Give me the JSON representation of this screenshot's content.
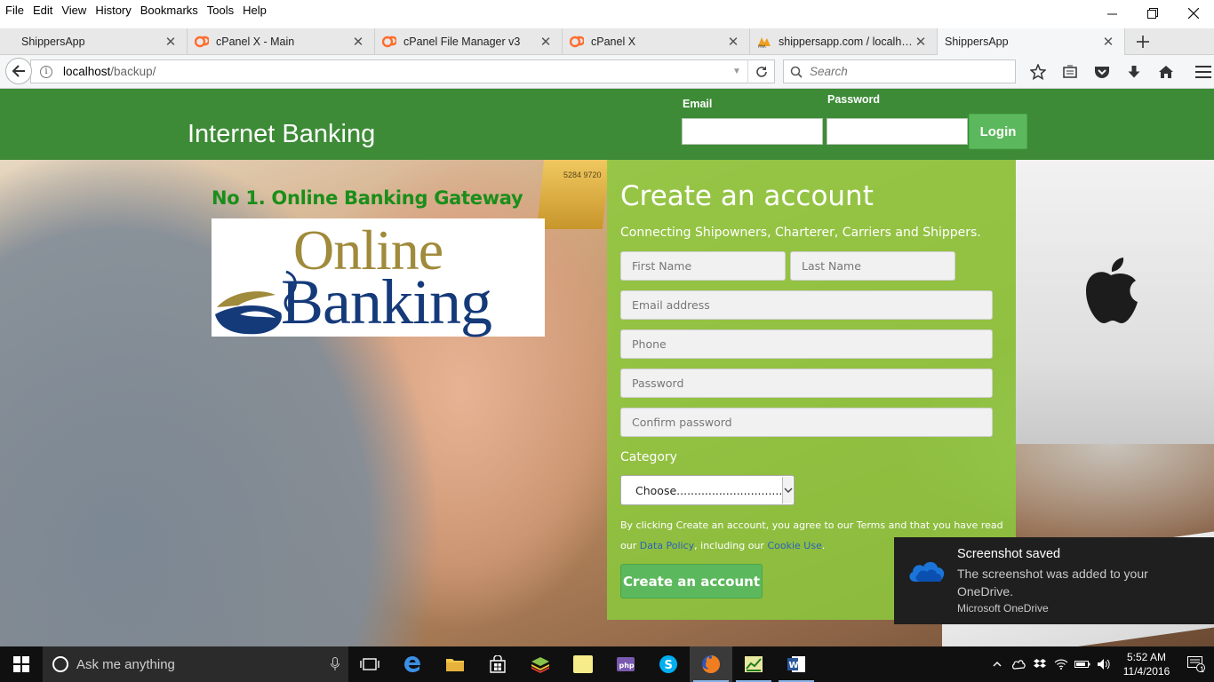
{
  "menubar": {
    "items": [
      {
        "label": "File"
      },
      {
        "label": "Edit"
      },
      {
        "label": "View"
      },
      {
        "label": "History"
      },
      {
        "label": "Bookmarks"
      },
      {
        "label": "Tools"
      },
      {
        "label": "Help"
      }
    ]
  },
  "tabs": [
    {
      "label": "ShippersApp",
      "icon": "none",
      "active": false
    },
    {
      "label": "cPanel X - Main",
      "icon": "cpanel-icon",
      "active": false
    },
    {
      "label": "cPanel File Manager v3",
      "icon": "cpanel-icon",
      "active": false
    },
    {
      "label": "cPanel X",
      "icon": "cpanel-icon",
      "active": false
    },
    {
      "label": "shippersapp.com / localh…",
      "icon": "phpmyadmin-icon",
      "active": false
    },
    {
      "label": "ShippersApp",
      "icon": "none",
      "active": true
    }
  ],
  "navbar": {
    "url_host": "localhost",
    "url_path": "/backup/",
    "search_placeholder": "Search"
  },
  "site": {
    "brand": "Internet Banking",
    "login": {
      "email_label": "Email",
      "password_label": "Password",
      "button": "Login"
    },
    "tagline": "No 1. Online Banking Gateway",
    "logo": {
      "line1": "Online",
      "line2": "Banking"
    },
    "hero_card_number": "5284 9720"
  },
  "signup": {
    "title": "Create an account",
    "subtitle": "Connecting Shipowners, Charterer, Carriers and Shippers.",
    "first_name_placeholder": "First Name",
    "last_name_placeholder": "Last Name",
    "email_placeholder": "Email address",
    "phone_placeholder": "Phone",
    "password_placeholder": "Password",
    "confirm_placeholder": "Confirm password",
    "category_label": "Category",
    "category_value": "Choose..............................",
    "legal_part1": "By clicking Create an account, you agree to our Terms and that you have read our ",
    "legal_link1": "Data Policy",
    "legal_part2": ", including our ",
    "legal_link2": "Cookie Use",
    "legal_part3": ".",
    "button": "Create an account"
  },
  "toast": {
    "title": "Screenshot saved",
    "body": "The screenshot was added to your OneDrive.",
    "source": "Microsoft OneDrive"
  },
  "taskbar": {
    "search_placeholder": "Ask me anything",
    "time": "5:52 AM",
    "date": "11/4/2016",
    "notification_count": "1"
  },
  "colors": {
    "header_green": "#3d8b37",
    "panel_green": "#8cc93c",
    "button_green": "#5cb85c",
    "tagline_green": "#1a8e1a",
    "logo_gold": "#a08a3b",
    "logo_navy": "#153a7a"
  }
}
